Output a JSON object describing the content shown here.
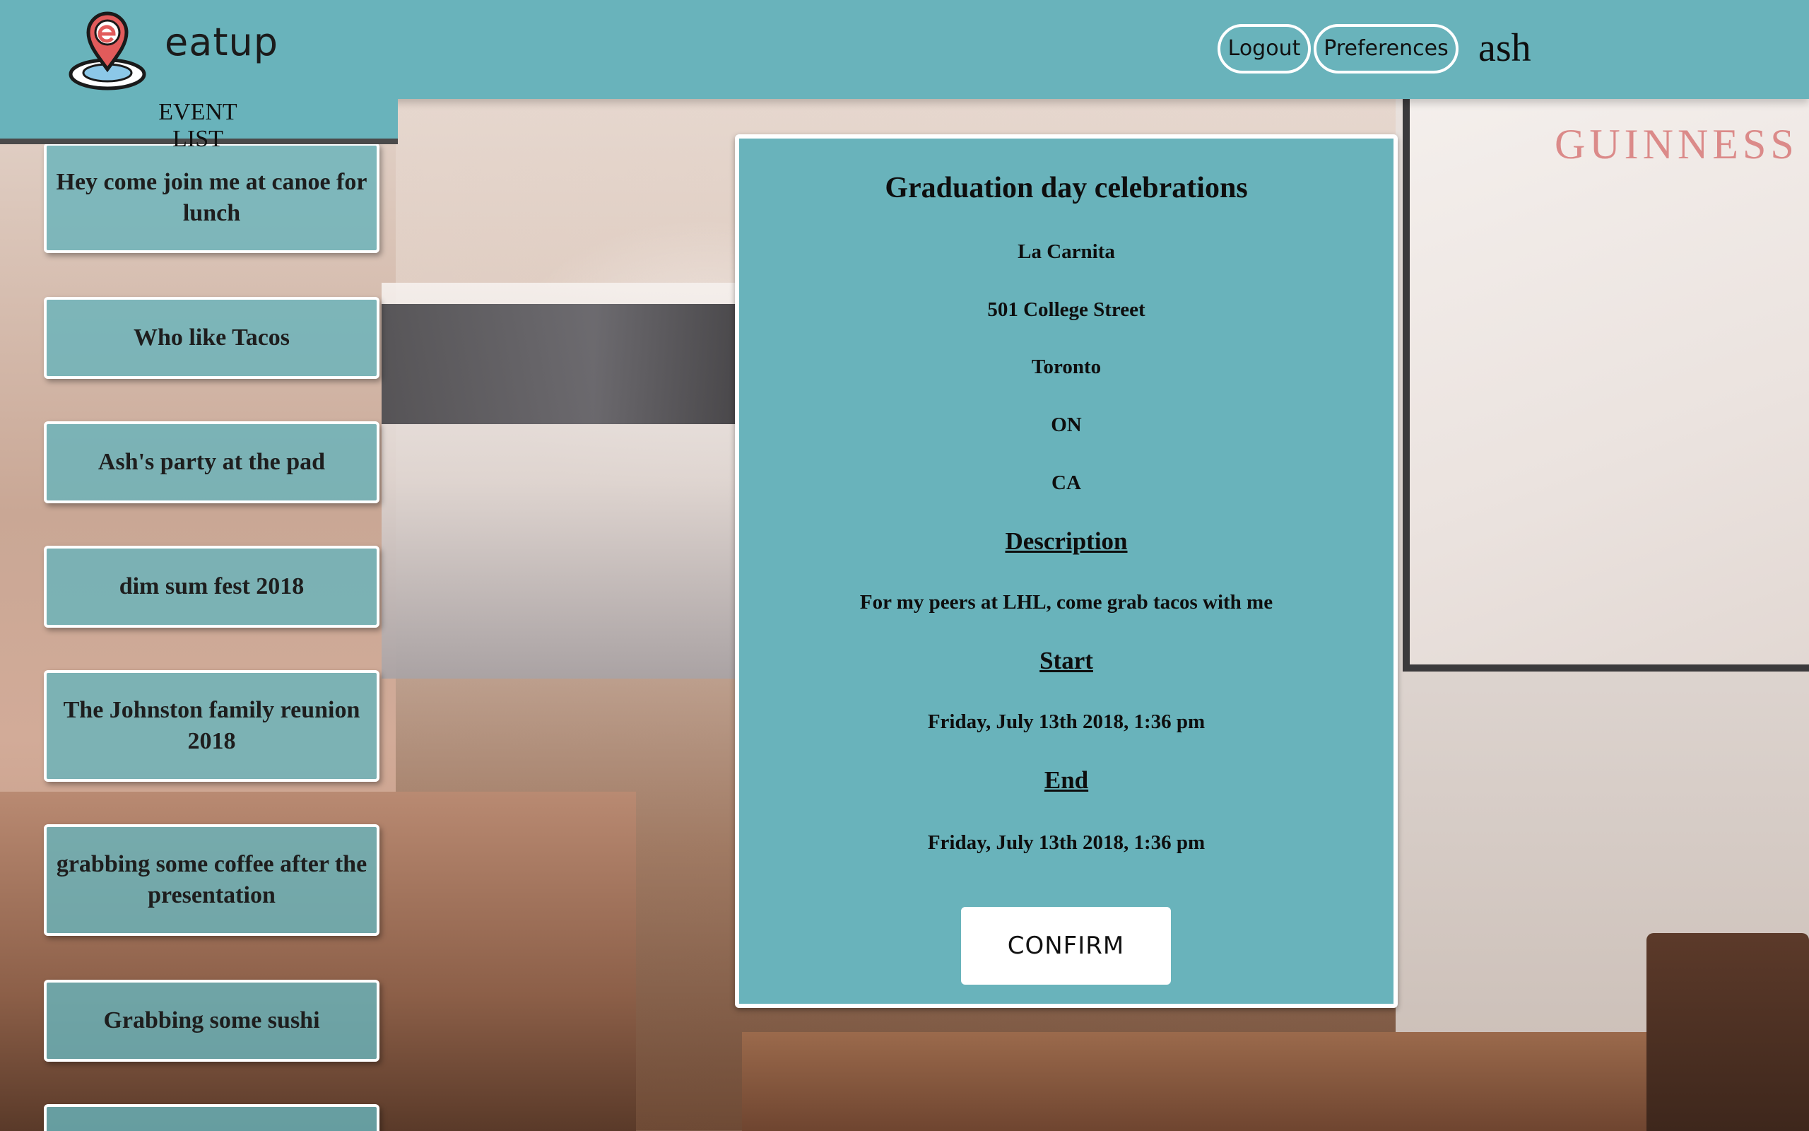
{
  "header": {
    "brand": "eatup",
    "logout_label": "Logout",
    "preferences_label": "Preferences",
    "username": "ash"
  },
  "event_list": {
    "title": "EVENT LIST",
    "items": [
      "Hey come join me at canoe for lunch",
      "Who like Tacos",
      "Ash's party at the pad",
      "dim sum fest 2018",
      "The Johnston family reunion 2018",
      "grabbing some coffee after the presentation",
      "Grabbing some sushi"
    ]
  },
  "event_detail": {
    "title": "Graduation day celebrations",
    "venue": "La Carnita",
    "street": "501 College Street",
    "city": "Toronto",
    "province": "ON",
    "country": "CA",
    "description_heading": "Description",
    "description": "For my peers at LHL, come grab tacos with me",
    "start_heading": "Start",
    "start": "Friday, July 13th 2018, 1:36 pm",
    "end_heading": "End",
    "end": "Friday, July 13th 2018, 1:36 pm",
    "confirm_label": "CONFIRM"
  },
  "background": {
    "poster_text": "GUINNESS"
  },
  "colors": {
    "accent": "#69b3bb",
    "logo_pin": "#e25b5b",
    "logo_base": "#8cc8e8"
  }
}
